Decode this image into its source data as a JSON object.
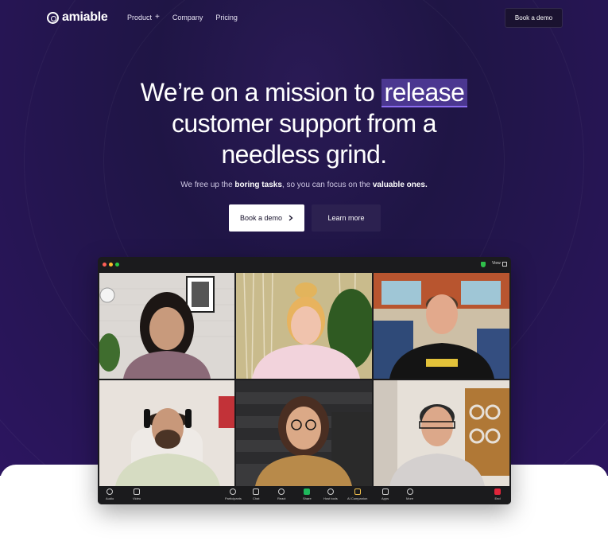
{
  "nav": {
    "logo_text": "amiable",
    "links": [
      {
        "label": "Product",
        "icon": "plus-icon"
      },
      {
        "label": "Company"
      },
      {
        "label": "Pricing"
      }
    ],
    "cta_label": "Book a demo"
  },
  "hero": {
    "headline_before": "We’re on a mission to",
    "headline_highlight": "release",
    "headline_line2": "customer support from a",
    "headline_line3": "needless grind.",
    "sub_before": "We free up the",
    "sub_bold_1": "boring tasks",
    "sub_middle": ", so you can focus on the",
    "sub_bold_2": "valuable ones.",
    "primary_button": "Book a demo",
    "secondary_button": "Learn more"
  },
  "video_call": {
    "view_label": "View",
    "toolbar": {
      "audio": "Audio",
      "video": "Video",
      "participants": "Participants",
      "chat": "Chat",
      "react": "React",
      "share": "Share",
      "host_tools": "Host tools",
      "ai_companion": "AI Companion",
      "apps": "Apps",
      "more": "More",
      "end": "End"
    }
  },
  "colors": {
    "hero_bg": "#1f1545",
    "highlight_bg": "#4b3790",
    "highlight_underline": "#8b6cf0"
  }
}
